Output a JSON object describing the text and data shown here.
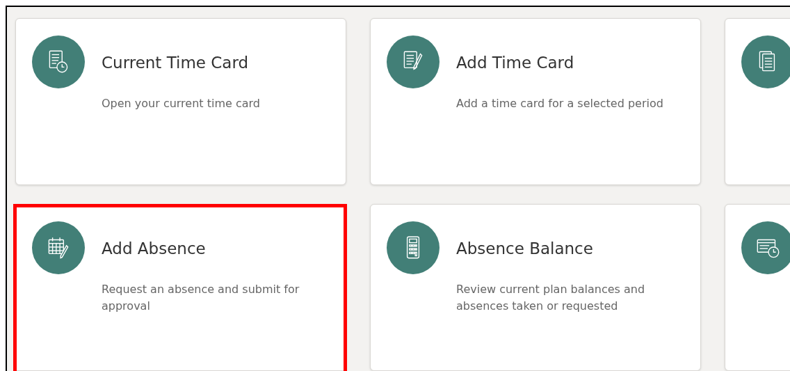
{
  "cards": [
    {
      "title": "Current Time Card",
      "description": "Open your current time card",
      "highlighted": false
    },
    {
      "title": "Add Time Card",
      "description": "Add a time card for a selected period",
      "highlighted": false
    },
    {
      "highlighted": false
    },
    {
      "title": "Add Absence",
      "description": "Request an absence and submit for approval",
      "highlighted": true
    },
    {
      "title": "Absence Balance",
      "description": "Review current plan balances and absences taken or requested",
      "highlighted": false
    },
    {
      "highlighted": false
    }
  ]
}
